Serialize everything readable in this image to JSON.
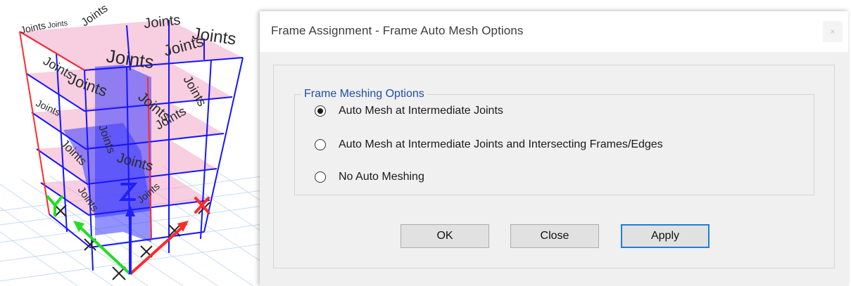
{
  "viewport": {
    "joint_labels": [
      "Joints",
      "Joints",
      "Joints",
      "Joints",
      "Joints",
      "Joints",
      "Joints",
      "Joints",
      "Joints",
      "Joints",
      "Joints",
      "Joints",
      "Joints",
      "Joints",
      "Joints",
      "Joints",
      "Joints",
      "Joints"
    ],
    "axis_colors": {
      "x": "#ff2a2a",
      "y": "#22dd22",
      "z": "#1e1eff"
    }
  },
  "dialog": {
    "title": "Frame Assignment - Frame Auto Mesh Options",
    "close_glyph": "×",
    "group_title": "Frame Meshing Options",
    "options": [
      {
        "label": "Auto Mesh at Intermediate Joints",
        "selected": true
      },
      {
        "label": "Auto Mesh at Intermediate Joints and Intersecting Frames/Edges",
        "selected": false
      },
      {
        "label": "No Auto Meshing",
        "selected": false
      }
    ],
    "buttons": {
      "ok": "OK",
      "close": "Close",
      "apply": "Apply"
    },
    "accent_color": "#1d7fd8",
    "group_title_color": "#1f4ea8"
  }
}
